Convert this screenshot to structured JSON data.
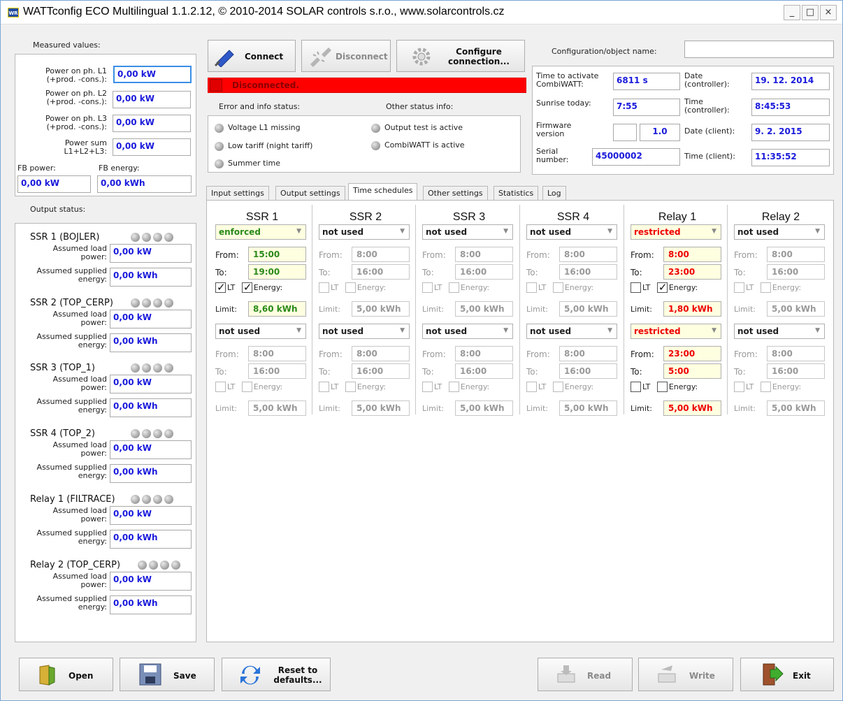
{
  "window": {
    "title": "WATTconfig ECO Multilingual 1.1.2.12, © 2010-2014 SOLAR controls s.r.o., www.solarcontrols.cz",
    "app_icon_text": "WR",
    "minimize": "_",
    "maximize": "□",
    "close": "×"
  },
  "measured": {
    "title": "Measured values:",
    "rows": [
      {
        "label1": "Power on ph. L1",
        "label2": "(+prod. -cons.):",
        "value": "0,00 kW"
      },
      {
        "label1": "Power on ph. L2",
        "label2": "(+prod. -cons.):",
        "value": "0,00 kW"
      },
      {
        "label1": "Power on ph. L3",
        "label2": "(+prod. -cons.):",
        "value": "0,00 kW"
      },
      {
        "label1": "Power sum",
        "label2": "L1+L2+L3:",
        "value": "0,00 kW"
      }
    ],
    "fb_power_label": "FB power:",
    "fb_energy_label": "FB energy:",
    "fb_power": "0,00 kW",
    "fb_energy": "0,00 kWh"
  },
  "output_status": {
    "title": "Output status:",
    "load_label1": "Assumed load",
    "load_label2": "power:",
    "energy_label1": "Assumed supplied",
    "energy_label2": "energy:",
    "outputs": [
      {
        "name": "SSR 1 (BOJLER)",
        "load": "0,00 kW",
        "energy": "0,00 kWh"
      },
      {
        "name": "SSR 2 (TOP_CERP)",
        "load": "0,00 kW",
        "energy": "0,00 kWh"
      },
      {
        "name": "SSR 3 (TOP_1)",
        "load": "0,00 kW",
        "energy": "0,00 kWh"
      },
      {
        "name": "SSR 4 (TOP_2)",
        "load": "0,00 kW",
        "energy": "0,00 kWh"
      },
      {
        "name": "Relay 1 (FILTRACE)",
        "load": "0,00 kW",
        "energy": "0,00 kWh"
      },
      {
        "name": "Relay 2 (TOP_CERP)",
        "load": "0,00 kW",
        "energy": "0,00 kWh"
      }
    ]
  },
  "toolbar": {
    "connect": "Connect",
    "disconnect": "Disconnect",
    "configure1": "Configure",
    "configure2": "connection..."
  },
  "status": {
    "text": "Disconnected.",
    "error_title": "Error and info status:",
    "other_title": "Other status info:",
    "error_items": [
      "Voltage L1 missing",
      "Low tariff (night tariff)",
      "Summer time"
    ],
    "other_items": [
      "Output test is active",
      "CombiWATT is active"
    ]
  },
  "config": {
    "object_name_label": "Configuration/object name:",
    "object_name_value": "",
    "combiwatt_label1": "Time to activate",
    "combiwatt_label2": "CombiWATT:",
    "combiwatt_value": "6811 s",
    "sunrise_label": "Sunrise today:",
    "sunrise_value": "7:55",
    "firmware_label1": "Firmware",
    "firmware_label2": "version",
    "firmware_value": "1.0",
    "serial_label1": "Serial",
    "serial_label2": "number:",
    "serial_value": "45000002",
    "date_ctrl_label1": "Date",
    "date_ctrl_label2": "(controller):",
    "date_ctrl_value": "19. 12. 2014",
    "time_ctrl_label1": "Time",
    "time_ctrl_label2": "(controller):",
    "time_ctrl_value": "8:45:53",
    "date_client_label": "Date (client):",
    "date_client_value": "9. 2. 2015",
    "time_client_label": "Time (client):",
    "time_client_value": "11:35:52"
  },
  "tabs": [
    "Input settings",
    "Output settings",
    "Time schedules",
    "Other settings",
    "Statistics",
    "Log"
  ],
  "schedule_labels": {
    "from": "From:",
    "to": "To:",
    "lt": "LT",
    "energy": "Energy:",
    "limit": "Limit:"
  },
  "schedules": [
    {
      "title": "SSR 1",
      "blocks": [
        {
          "mode": "enforced",
          "from": "15:00",
          "to": "19:00",
          "lt": true,
          "energy": true,
          "limit": "8,60 kWh",
          "style": "grn"
        },
        {
          "mode": "not used",
          "from": "8:00",
          "to": "16:00",
          "lt": false,
          "energy": false,
          "limit": "5,00 kWh",
          "style": "dis"
        }
      ]
    },
    {
      "title": "SSR 2",
      "blocks": [
        {
          "mode": "not used",
          "from": "8:00",
          "to": "16:00",
          "lt": false,
          "energy": false,
          "limit": "5,00 kWh",
          "style": "dis"
        },
        {
          "mode": "not used",
          "from": "8:00",
          "to": "16:00",
          "lt": false,
          "energy": false,
          "limit": "5,00 kWh",
          "style": "dis"
        }
      ]
    },
    {
      "title": "SSR 3",
      "blocks": [
        {
          "mode": "not used",
          "from": "8:00",
          "to": "16:00",
          "lt": false,
          "energy": false,
          "limit": "5,00 kWh",
          "style": "dis"
        },
        {
          "mode": "not used",
          "from": "8:00",
          "to": "16:00",
          "lt": false,
          "energy": false,
          "limit": "5,00 kWh",
          "style": "dis"
        }
      ]
    },
    {
      "title": "SSR 4",
      "blocks": [
        {
          "mode": "not used",
          "from": "8:00",
          "to": "16:00",
          "lt": false,
          "energy": false,
          "limit": "5,00 kWh",
          "style": "dis"
        },
        {
          "mode": "not used",
          "from": "8:00",
          "to": "16:00",
          "lt": false,
          "energy": false,
          "limit": "5,00 kWh",
          "style": "dis"
        }
      ]
    },
    {
      "title": "Relay 1",
      "blocks": [
        {
          "mode": "restricted",
          "from": "8:00",
          "to": "23:00",
          "lt": false,
          "energy": true,
          "limit": "1,80 kWh",
          "style": "red"
        },
        {
          "mode": "restricted",
          "from": "23:00",
          "to": "5:00",
          "lt": false,
          "energy": false,
          "limit": "5,00 kWh",
          "style": "red"
        }
      ]
    },
    {
      "title": "Relay 2",
      "blocks": [
        {
          "mode": "not used",
          "from": "8:00",
          "to": "16:00",
          "lt": false,
          "energy": false,
          "limit": "5,00 kWh",
          "style": "dis"
        },
        {
          "mode": "not used",
          "from": "8:00",
          "to": "16:00",
          "lt": false,
          "energy": false,
          "limit": "5,00 kWh",
          "style": "dis"
        }
      ]
    }
  ],
  "bottom": {
    "open": "Open",
    "save": "Save",
    "reset1": "Reset to",
    "reset2": "defaults...",
    "read": "Read",
    "write": "Write",
    "exit": "Exit"
  },
  "colors": {
    "status_red": "#ff0000",
    "value_blue": "#1a1adc",
    "enforced_green": "#2b8a1a",
    "restricted_red": "#e00000"
  }
}
